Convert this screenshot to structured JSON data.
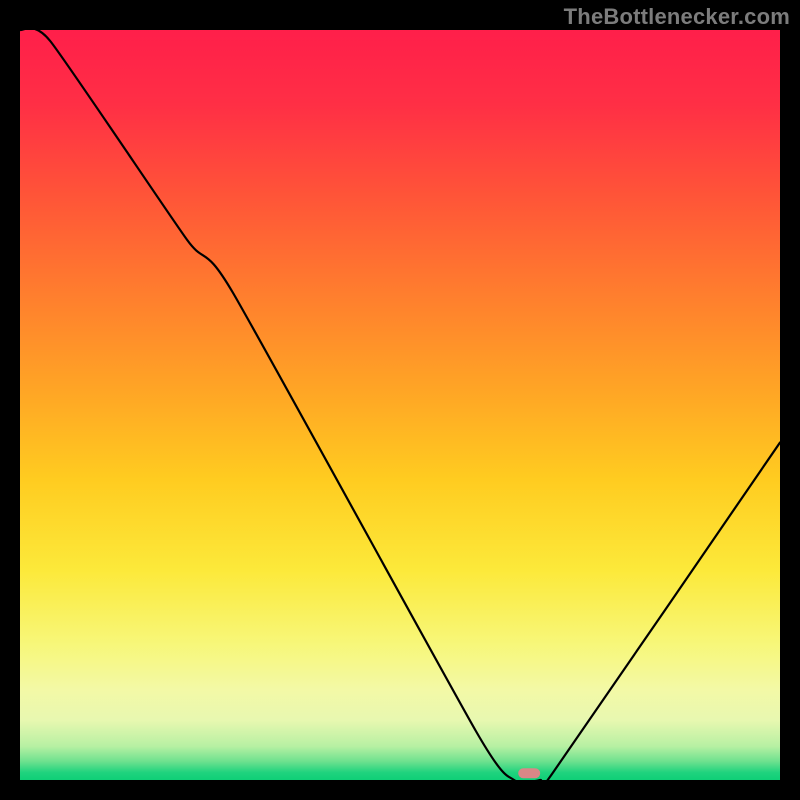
{
  "attribution": "TheBottlenecker.com",
  "chart_data": {
    "type": "line",
    "title": "",
    "xlabel": "",
    "ylabel": "",
    "xlim": [
      0,
      100
    ],
    "ylim": [
      0,
      100
    ],
    "x": [
      0,
      4,
      22,
      28,
      60,
      65,
      68.5,
      70,
      100
    ],
    "y": [
      100,
      98.5,
      72,
      65,
      6.5,
      0,
      0,
      0.8,
      45
    ],
    "marker": {
      "x": 67,
      "y": 0.9,
      "color": "#d98787"
    },
    "gradient_stops": [
      {
        "offset": 0.0,
        "color": "#ff1f4a"
      },
      {
        "offset": 0.1,
        "color": "#ff2f45"
      },
      {
        "offset": 0.22,
        "color": "#ff5438"
      },
      {
        "offset": 0.35,
        "color": "#ff7d2e"
      },
      {
        "offset": 0.48,
        "color": "#ffa525"
      },
      {
        "offset": 0.6,
        "color": "#ffcc20"
      },
      {
        "offset": 0.72,
        "color": "#fce93a"
      },
      {
        "offset": 0.82,
        "color": "#f7f77a"
      },
      {
        "offset": 0.88,
        "color": "#f3f9a6"
      },
      {
        "offset": 0.92,
        "color": "#e8f8b0"
      },
      {
        "offset": 0.955,
        "color": "#b7f0a3"
      },
      {
        "offset": 0.975,
        "color": "#6fe18f"
      },
      {
        "offset": 0.99,
        "color": "#1fd37e"
      },
      {
        "offset": 1.0,
        "color": "#0fcf77"
      }
    ]
  }
}
